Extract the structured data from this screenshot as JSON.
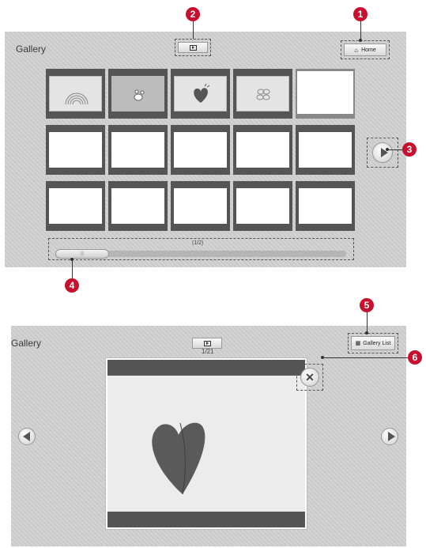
{
  "top_panel": {
    "title": "Gallery",
    "home_label": "Home",
    "home_icon": "home-icon",
    "slideshow_icon": "play-icon",
    "next_icon": "next-arrow-icon",
    "page_indicator": "(1/2)",
    "scroll_position": 0.22,
    "thumbnails": [
      {
        "type": "rainbow"
      },
      {
        "type": "character"
      },
      {
        "type": "heart"
      },
      {
        "type": "flower"
      },
      {
        "type": "blank"
      },
      {
        "type": "blank"
      },
      {
        "type": "blank"
      },
      {
        "type": "blank"
      },
      {
        "type": "blank"
      },
      {
        "type": "blank"
      },
      {
        "type": "blank"
      },
      {
        "type": "blank"
      },
      {
        "type": "blank"
      },
      {
        "type": "blank"
      },
      {
        "type": "blank"
      }
    ]
  },
  "bottom_panel": {
    "title": "Gallery",
    "gallery_list_label": "Gallery List",
    "gallery_list_icon": "grid-icon",
    "slideshow_icon": "play-icon",
    "counter": "1/21",
    "close_icon": "close-icon",
    "prev_icon": "prev-arrow-icon",
    "next_icon": "next-arrow-icon"
  },
  "callouts": [
    "1",
    "2",
    "3",
    "4",
    "5",
    "6"
  ],
  "colors": {
    "callout": "#c8102e",
    "panel": "#cfcfcf",
    "frame": "#555555"
  }
}
